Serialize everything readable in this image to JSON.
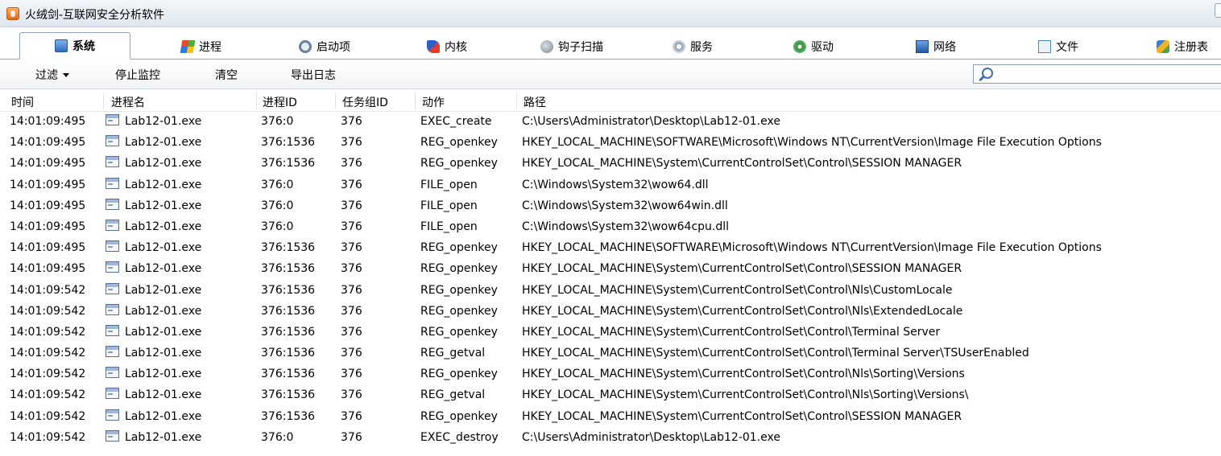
{
  "window": {
    "title": "火绒剑-互联网安全分析软件"
  },
  "tabs": [
    {
      "label": "系统",
      "icon": "system-icon",
      "active": true
    },
    {
      "label": "进程",
      "icon": "process-icon",
      "active": false
    },
    {
      "label": "启动项",
      "icon": "startup-icon",
      "active": false
    },
    {
      "label": "内核",
      "icon": "kernel-icon",
      "active": false
    },
    {
      "label": "钩子扫描",
      "icon": "hook-scan-icon",
      "active": false
    },
    {
      "label": "服务",
      "icon": "service-icon",
      "active": false
    },
    {
      "label": "驱动",
      "icon": "driver-icon",
      "active": false
    },
    {
      "label": "网络",
      "icon": "network-icon",
      "active": false
    },
    {
      "label": "文件",
      "icon": "file-icon",
      "active": false
    },
    {
      "label": "注册表",
      "icon": "registry-icon",
      "active": false
    }
  ],
  "toolbar": {
    "filter_label": "过滤",
    "stop_monitor_label": "停止监控",
    "clear_label": "清空",
    "export_log_label": "导出日志",
    "search": {
      "value": "",
      "placeholder": ""
    }
  },
  "table": {
    "columns": [
      "时间",
      "进程名",
      "进程ID",
      "任务组ID",
      "动作",
      "路径"
    ],
    "rows": [
      [
        "14:01:09:495",
        "Lab12-01.exe",
        "376:0",
        "376",
        "EXEC_create",
        "C:\\Users\\Administrator\\Desktop\\Lab12-01.exe"
      ],
      [
        "14:01:09:495",
        "Lab12-01.exe",
        "376:1536",
        "376",
        "REG_openkey",
        "HKEY_LOCAL_MACHINE\\SOFTWARE\\Microsoft\\Windows NT\\CurrentVersion\\Image File Execution Options"
      ],
      [
        "14:01:09:495",
        "Lab12-01.exe",
        "376:1536",
        "376",
        "REG_openkey",
        "HKEY_LOCAL_MACHINE\\System\\CurrentControlSet\\Control\\SESSION MANAGER"
      ],
      [
        "14:01:09:495",
        "Lab12-01.exe",
        "376:0",
        "376",
        "FILE_open",
        "C:\\Windows\\System32\\wow64.dll"
      ],
      [
        "14:01:09:495",
        "Lab12-01.exe",
        "376:0",
        "376",
        "FILE_open",
        "C:\\Windows\\System32\\wow64win.dll"
      ],
      [
        "14:01:09:495",
        "Lab12-01.exe",
        "376:0",
        "376",
        "FILE_open",
        "C:\\Windows\\System32\\wow64cpu.dll"
      ],
      [
        "14:01:09:495",
        "Lab12-01.exe",
        "376:1536",
        "376",
        "REG_openkey",
        "HKEY_LOCAL_MACHINE\\SOFTWARE\\Microsoft\\Windows NT\\CurrentVersion\\Image File Execution Options"
      ],
      [
        "14:01:09:495",
        "Lab12-01.exe",
        "376:1536",
        "376",
        "REG_openkey",
        "HKEY_LOCAL_MACHINE\\System\\CurrentControlSet\\Control\\SESSION MANAGER"
      ],
      [
        "14:01:09:542",
        "Lab12-01.exe",
        "376:1536",
        "376",
        "REG_openkey",
        "HKEY_LOCAL_MACHINE\\System\\CurrentControlSet\\Control\\Nls\\CustomLocale"
      ],
      [
        "14:01:09:542",
        "Lab12-01.exe",
        "376:1536",
        "376",
        "REG_openkey",
        "HKEY_LOCAL_MACHINE\\System\\CurrentControlSet\\Control\\Nls\\ExtendedLocale"
      ],
      [
        "14:01:09:542",
        "Lab12-01.exe",
        "376:1536",
        "376",
        "REG_openkey",
        "HKEY_LOCAL_MACHINE\\System\\CurrentControlSet\\Control\\Terminal Server"
      ],
      [
        "14:01:09:542",
        "Lab12-01.exe",
        "376:1536",
        "376",
        "REG_getval",
        "HKEY_LOCAL_MACHINE\\System\\CurrentControlSet\\Control\\Terminal Server\\TSUserEnabled"
      ],
      [
        "14:01:09:542",
        "Lab12-01.exe",
        "376:1536",
        "376",
        "REG_openkey",
        "HKEY_LOCAL_MACHINE\\System\\CurrentControlSet\\Control\\Nls\\Sorting\\Versions"
      ],
      [
        "14:01:09:542",
        "Lab12-01.exe",
        "376:1536",
        "376",
        "REG_getval",
        "HKEY_LOCAL_MACHINE\\System\\CurrentControlSet\\Control\\Nls\\Sorting\\Versions\\"
      ],
      [
        "14:01:09:542",
        "Lab12-01.exe",
        "376:1536",
        "376",
        "REG_openkey",
        "HKEY_LOCAL_MACHINE\\System\\CurrentControlSet\\Control\\SESSION MANAGER"
      ],
      [
        "14:01:09:542",
        "Lab12-01.exe",
        "376:0",
        "376",
        "EXEC_destroy",
        "C:\\Users\\Administrator\\Desktop\\Lab12-01.exe"
      ]
    ]
  }
}
